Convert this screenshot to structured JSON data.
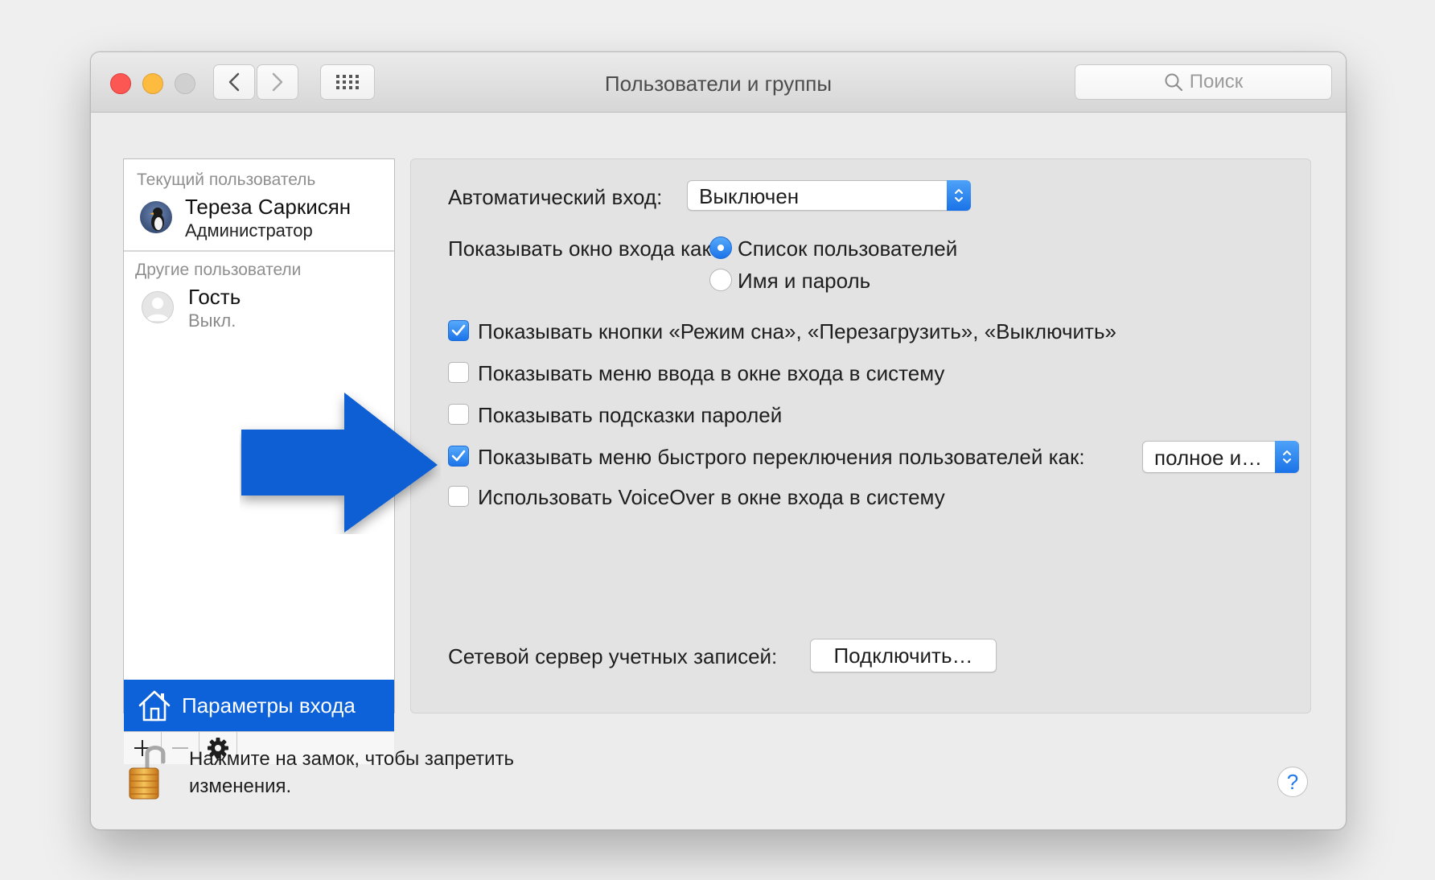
{
  "window": {
    "title": "Пользователи и группы",
    "search_placeholder": "Поиск"
  },
  "sidebar": {
    "current_header": "Текущий пользователь",
    "current_user": {
      "name": "Тереза Саркисян",
      "role": "Администратор"
    },
    "others_header": "Другие пользователи",
    "guest": {
      "name": "Гость",
      "status": "Выкл."
    },
    "login_options_label": "Параметры входа"
  },
  "panel": {
    "auto_login_label": "Автоматический вход:",
    "auto_login_value": "Выключен",
    "display_login_label": "Показывать окно входа как:",
    "display_options": [
      {
        "label": "Список пользователей",
        "selected": true
      },
      {
        "label": "Имя и пароль",
        "selected": false
      }
    ],
    "checkboxes": [
      {
        "label": "Показывать кнопки «Режим сна», «Перезагрузить», «Выключить»",
        "checked": true
      },
      {
        "label": "Показывать меню ввода в окне входа в систему",
        "checked": false
      },
      {
        "label": "Показывать подсказки паролей",
        "checked": false
      },
      {
        "label": "Показывать меню быстрого переключения пользователей как:",
        "checked": true
      },
      {
        "label": "Использовать VoiceOver в окне входа в систему",
        "checked": false
      }
    ],
    "fast_switch_value": "полное и…",
    "network_server_label": "Сетевой сервер учетных записей:",
    "join_button": "Подключить…"
  },
  "footer": {
    "lock_text": "Нажмите на замок, чтобы запретить изменения.",
    "help_label": "?"
  },
  "colors": {
    "accent": "#0d62d9",
    "annotation_arrow": "#0a5fd3",
    "close": "#fc5753",
    "minimize": "#fdbc40"
  }
}
